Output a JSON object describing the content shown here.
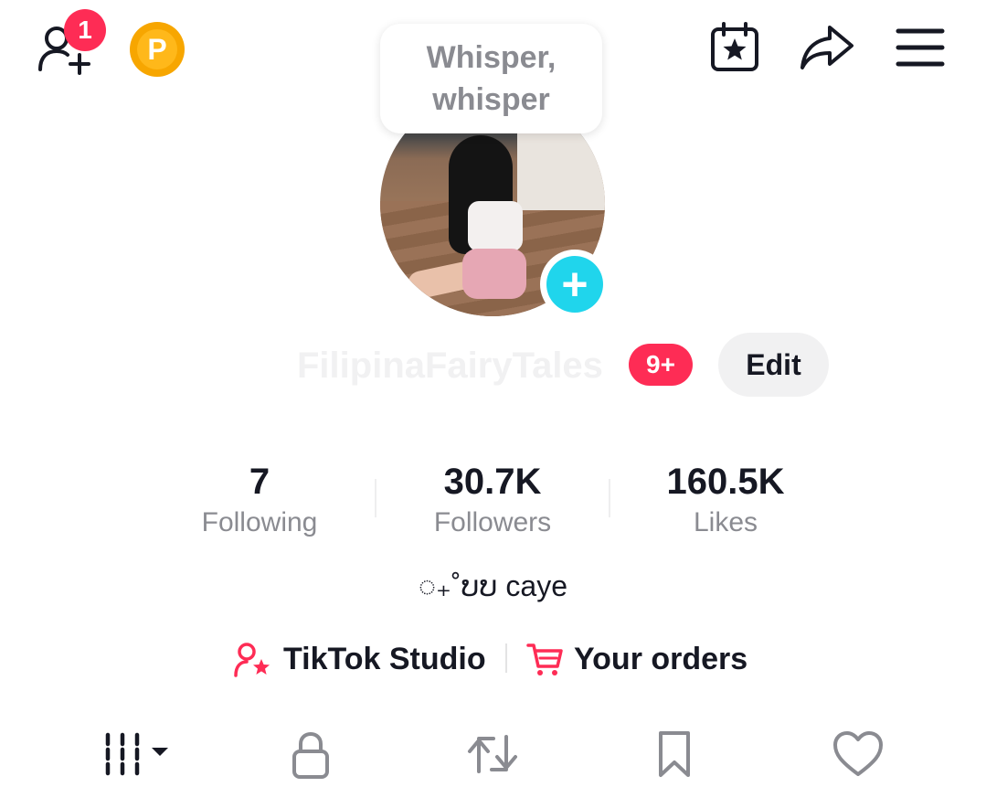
{
  "top_bar": {
    "notification_count": "1",
    "coin_label": "P"
  },
  "bubble": {
    "line1": "Whisper,",
    "line2": "whisper"
  },
  "profile": {
    "username": "FilipinaFairyTales",
    "unread_badge": "9+",
    "edit_label": "Edit"
  },
  "stats": [
    {
      "value": "7",
      "label": "Following"
    },
    {
      "value": "30.7K",
      "label": "Followers"
    },
    {
      "value": "160.5K",
      "label": "Likes"
    }
  ],
  "bio": "◌₊˚ບບ caye",
  "links": {
    "studio": "TikTok Studio",
    "orders": "Your orders"
  },
  "tabs": [
    "videos",
    "private",
    "reposts",
    "favorites",
    "liked"
  ],
  "colors": {
    "accent": "#fe2c55",
    "cyan": "#20d5ec",
    "coin": "#f7a600"
  }
}
